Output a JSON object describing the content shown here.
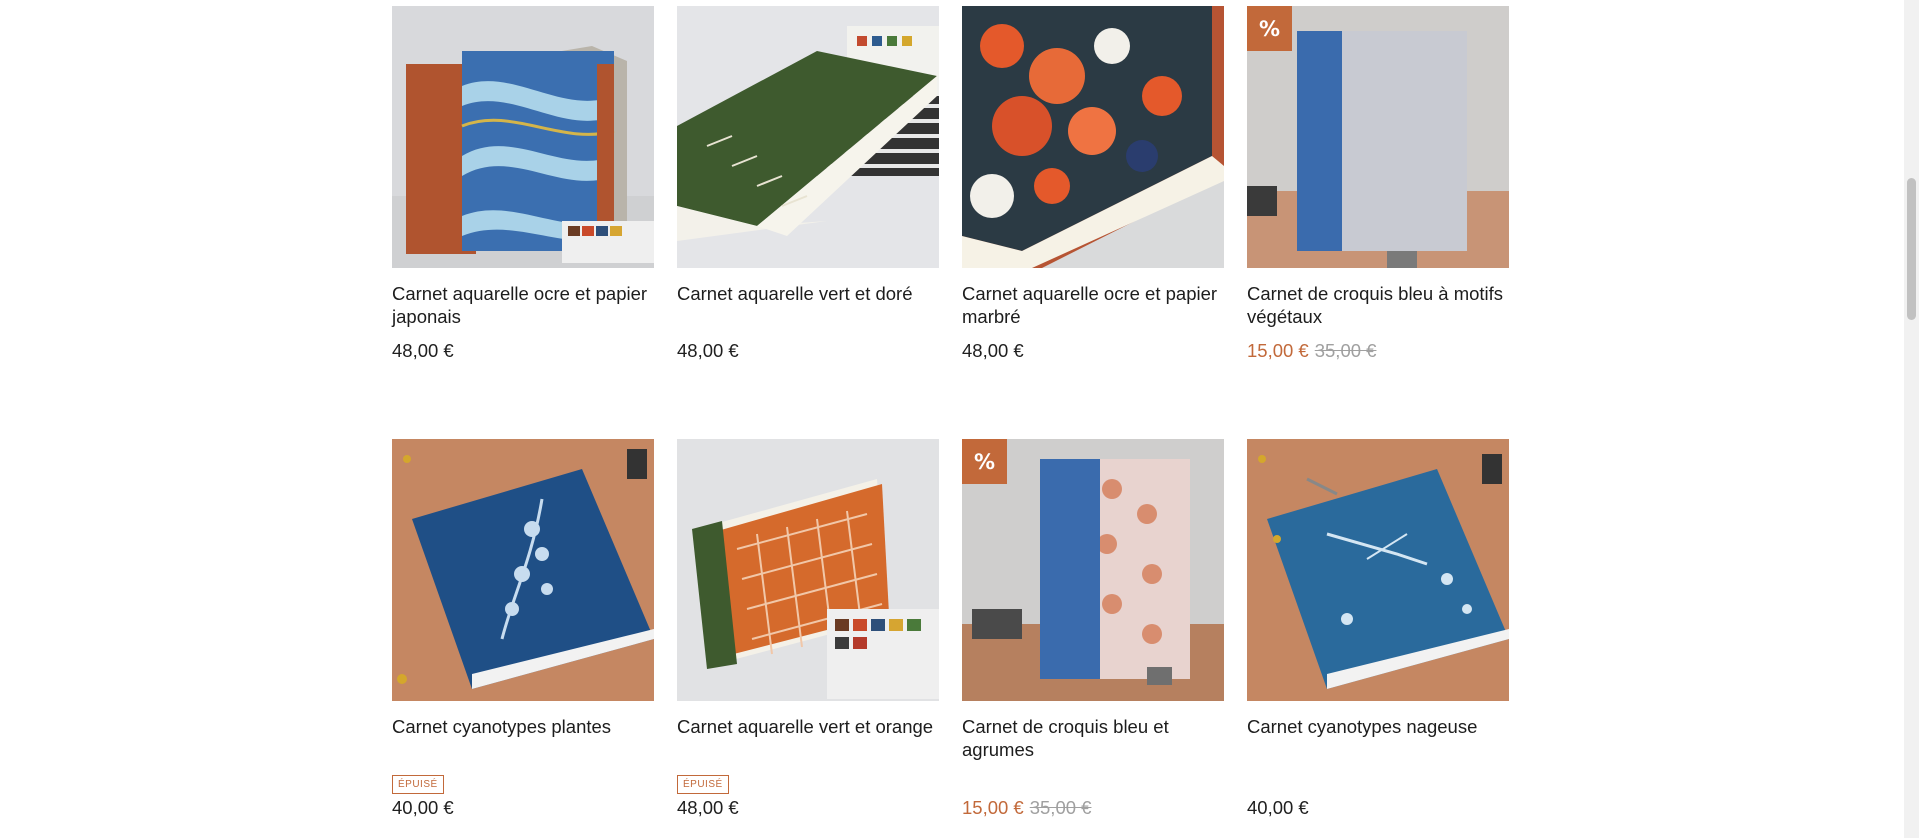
{
  "products": [
    {
      "title": "Carnet aquarelle ocre et papier japonais",
      "price": "48,00 €",
      "old_price": "",
      "badge": "",
      "stock": ""
    },
    {
      "title": "Carnet aquarelle vert et doré",
      "price": "48,00 €",
      "old_price": "",
      "badge": "",
      "stock": ""
    },
    {
      "title": "Carnet aquarelle ocre et papier marbré",
      "price": "48,00 €",
      "old_price": "",
      "badge": "",
      "stock": ""
    },
    {
      "title": "Carnet de croquis bleu à motifs végétaux",
      "price": "15,00 €",
      "old_price": "35,00 €",
      "badge": "%",
      "stock": ""
    },
    {
      "title": "Carnet cyanotypes plantes",
      "price": "40,00 €",
      "old_price": "",
      "badge": "",
      "stock": "ÉPUISÉ"
    },
    {
      "title": "Carnet aquarelle vert et orange",
      "price": "48,00 €",
      "old_price": "",
      "badge": "",
      "stock": "ÉPUISÉ"
    },
    {
      "title": "Carnet de croquis bleu et agrumes",
      "price": "15,00 €",
      "old_price": "35,00 €",
      "badge": "%",
      "stock": ""
    },
    {
      "title": "Carnet cyanotypes nageuse",
      "price": "40,00 €",
      "old_price": "",
      "badge": "",
      "stock": ""
    }
  ],
  "colors": {
    "accent": "#c2693a",
    "old_price": "#a0a0a0",
    "text": "#1d1d1d"
  }
}
